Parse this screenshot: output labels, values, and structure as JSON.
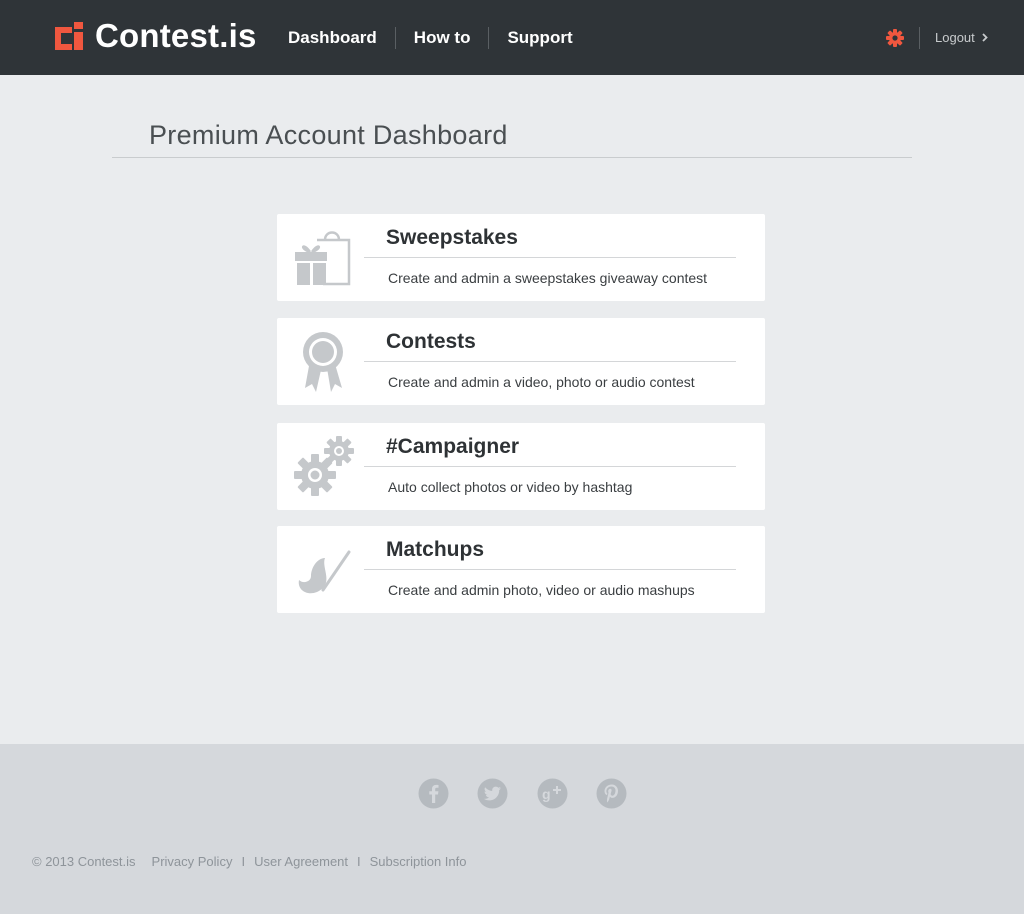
{
  "header": {
    "logo_text": "Contest.is",
    "nav": [
      {
        "label": "Dashboard"
      },
      {
        "label": "How to"
      },
      {
        "label": "Support"
      }
    ],
    "settings_icon": "gear-icon",
    "logout_label": "Logout"
  },
  "page": {
    "title": "Premium Account Dashboard"
  },
  "cards": [
    {
      "title": "Sweepstakes",
      "description": "Create and admin a sweepstakes giveaway contest",
      "icon": "gift-bag-icon"
    },
    {
      "title": "Contests",
      "description": "Create and admin a video, photo or audio contest",
      "icon": "ribbon-award-icon"
    },
    {
      "title": "#Campaigner",
      "description": "Auto collect photos or video by hashtag",
      "icon": "gears-icon"
    },
    {
      "title": "Matchups",
      "description": "Create and admin photo, video or audio mashups",
      "icon": "paintbrush-icon"
    }
  ],
  "footer": {
    "social": [
      "facebook-icon",
      "twitter-icon",
      "google-plus-icon",
      "pinterest-icon"
    ],
    "copyright": "© 2013 Contest.is",
    "links": [
      {
        "label": "Privacy Policy"
      },
      {
        "label": "User Agreement"
      },
      {
        "label": "Subscription Info"
      }
    ],
    "separator": "I"
  },
  "colors": {
    "header_bg": "#2f3438",
    "accent": "#f0573f",
    "page_bg": "#eaecee",
    "footer_bg": "#d5d8dc",
    "icon_gray": "#c5c8cb"
  }
}
